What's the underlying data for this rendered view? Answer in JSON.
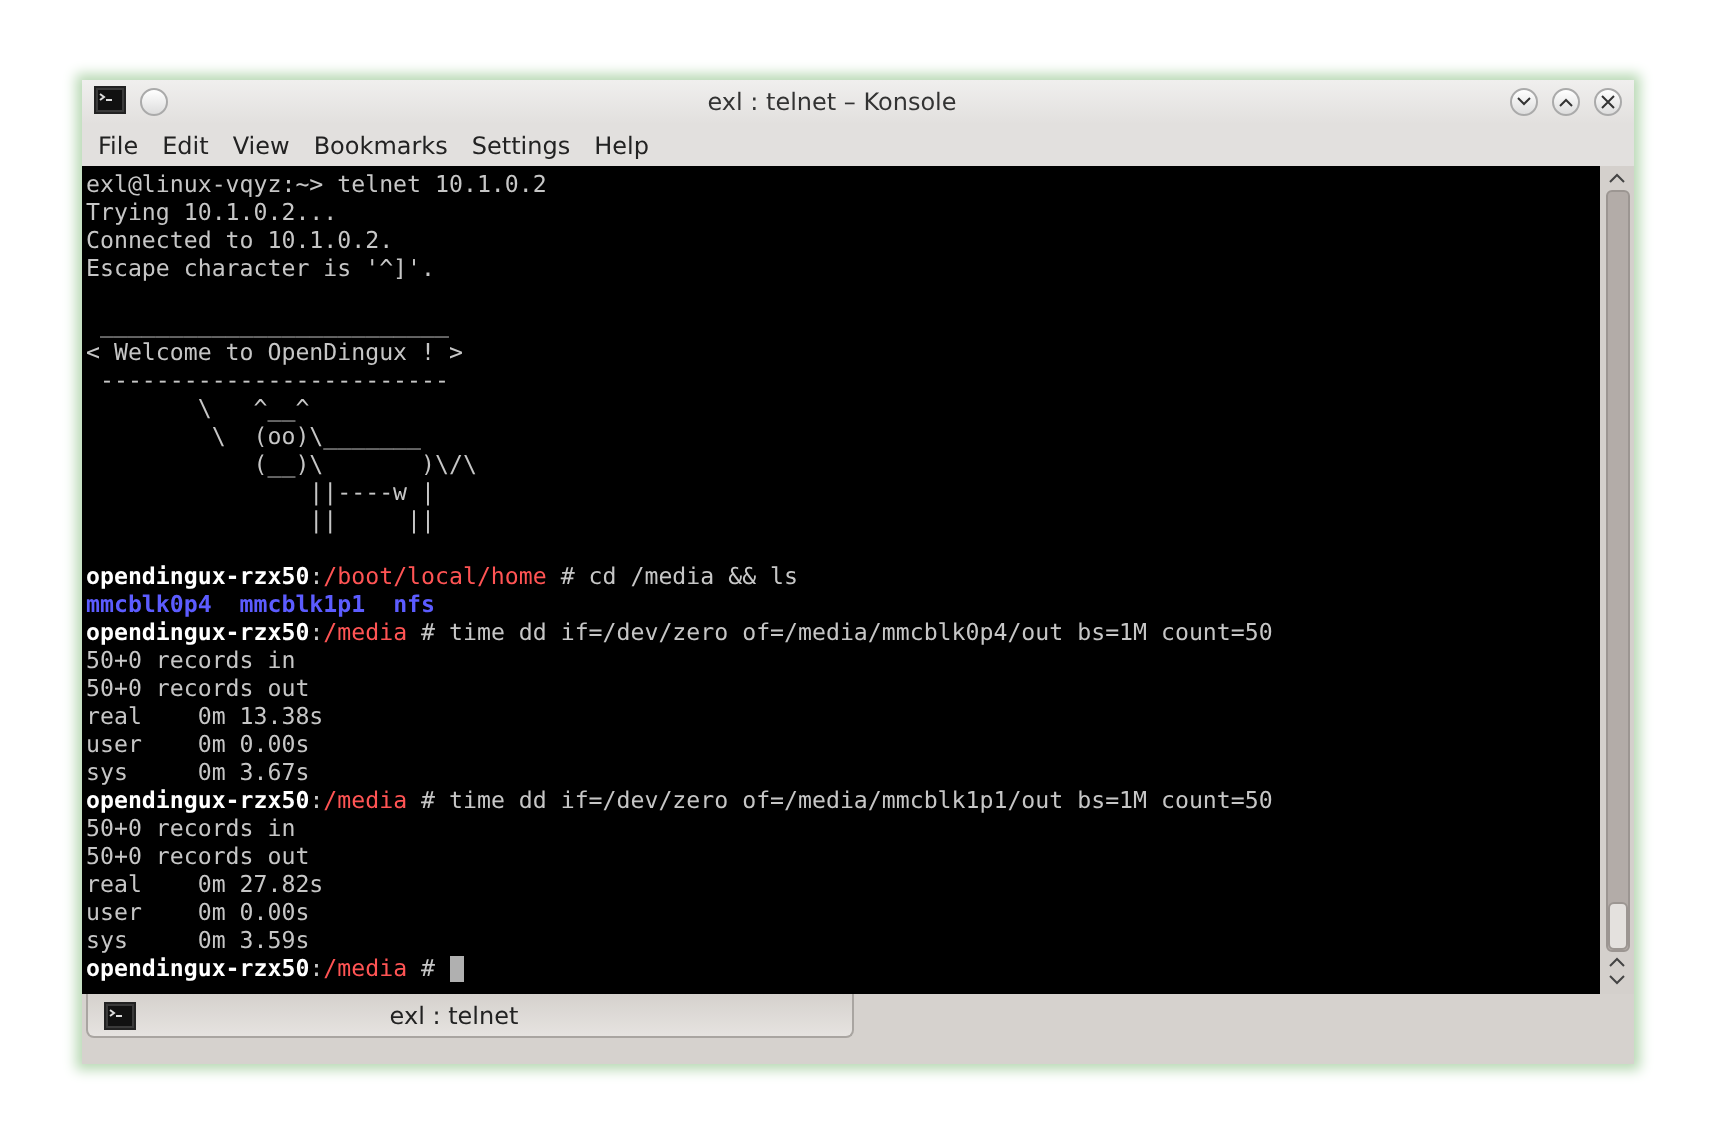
{
  "window": {
    "title": "exl : telnet – Konsole"
  },
  "menu": [
    "File",
    "Edit",
    "View",
    "Bookmarks",
    "Settings",
    "Help"
  ],
  "terminal": {
    "blocks": [
      {
        "lines": [
          {
            "segments": [
              {
                "kind": "plain",
                "text": "exl@linux-vqyz:~> telnet 10.1.0.2"
              }
            ]
          },
          {
            "segments": [
              {
                "kind": "plain",
                "text": "Trying 10.1.0.2..."
              }
            ]
          },
          {
            "segments": [
              {
                "kind": "plain",
                "text": "Connected to 10.1.0.2."
              }
            ]
          },
          {
            "segments": [
              {
                "kind": "plain",
                "text": "Escape character is '^]'."
              }
            ]
          }
        ]
      },
      {
        "lines": [
          {
            "segments": [
              {
                "kind": "plain",
                "text": " _________________________"
              }
            ]
          },
          {
            "segments": [
              {
                "kind": "plain",
                "text": "< Welcome to OpenDingux ! >"
              }
            ]
          },
          {
            "segments": [
              {
                "kind": "plain",
                "text": " -------------------------"
              }
            ]
          },
          {
            "segments": [
              {
                "kind": "plain",
                "text": "        \\   ^__^"
              }
            ]
          },
          {
            "segments": [
              {
                "kind": "plain",
                "text": "         \\  (oo)\\_______"
              }
            ]
          },
          {
            "segments": [
              {
                "kind": "plain",
                "text": "            (__)\\       )\\/\\"
              }
            ]
          },
          {
            "segments": [
              {
                "kind": "plain",
                "text": "                ||----w |"
              }
            ]
          },
          {
            "segments": [
              {
                "kind": "plain",
                "text": "                ||     ||"
              }
            ]
          }
        ]
      },
      {
        "lines": [
          {
            "segments": [
              {
                "kind": "host",
                "text": "opendingux-rzx50"
              },
              {
                "kind": "plain",
                "text": ":"
              },
              {
                "kind": "path",
                "text": "/boot/local/home"
              },
              {
                "kind": "plain",
                "text": " # cd /media && ls"
              }
            ]
          },
          {
            "segments": [
              {
                "kind": "dirs",
                "items": [
                  "mmcblk0p4",
                  "mmcblk1p1",
                  "nfs"
                ]
              }
            ]
          },
          {
            "segments": [
              {
                "kind": "host",
                "text": "opendingux-rzx50"
              },
              {
                "kind": "plain",
                "text": ":"
              },
              {
                "kind": "path",
                "text": "/media"
              },
              {
                "kind": "plain",
                "text": " # time dd if=/dev/zero of=/media/mmcblk0p4/out bs=1M count=50"
              }
            ]
          },
          {
            "segments": [
              {
                "kind": "plain",
                "text": "50+0 records in"
              }
            ]
          },
          {
            "segments": [
              {
                "kind": "plain",
                "text": "50+0 records out"
              }
            ]
          },
          {
            "segments": [
              {
                "kind": "plain",
                "text": "real    0m 13.38s"
              }
            ]
          },
          {
            "segments": [
              {
                "kind": "plain",
                "text": "user    0m 0.00s"
              }
            ]
          },
          {
            "segments": [
              {
                "kind": "plain",
                "text": "sys     0m 3.67s"
              }
            ]
          },
          {
            "segments": [
              {
                "kind": "host",
                "text": "opendingux-rzx50"
              },
              {
                "kind": "plain",
                "text": ":"
              },
              {
                "kind": "path",
                "text": "/media"
              },
              {
                "kind": "plain",
                "text": " # time dd if=/dev/zero of=/media/mmcblk1p1/out bs=1M count=50"
              }
            ]
          },
          {
            "segments": [
              {
                "kind": "plain",
                "text": "50+0 records in"
              }
            ]
          },
          {
            "segments": [
              {
                "kind": "plain",
                "text": "50+0 records out"
              }
            ]
          },
          {
            "segments": [
              {
                "kind": "plain",
                "text": "real    0m 27.82s"
              }
            ]
          },
          {
            "segments": [
              {
                "kind": "plain",
                "text": "user    0m 0.00s"
              }
            ]
          },
          {
            "segments": [
              {
                "kind": "plain",
                "text": "sys     0m 3.59s"
              }
            ]
          },
          {
            "segments": [
              {
                "kind": "host",
                "text": "opendingux-rzx50"
              },
              {
                "kind": "plain",
                "text": ":"
              },
              {
                "kind": "path",
                "text": "/media"
              },
              {
                "kind": "plain",
                "text": " # "
              },
              {
                "kind": "cursor"
              }
            ]
          }
        ]
      }
    ]
  },
  "tabs": [
    {
      "label": "exl : telnet",
      "selected": true
    }
  ]
}
